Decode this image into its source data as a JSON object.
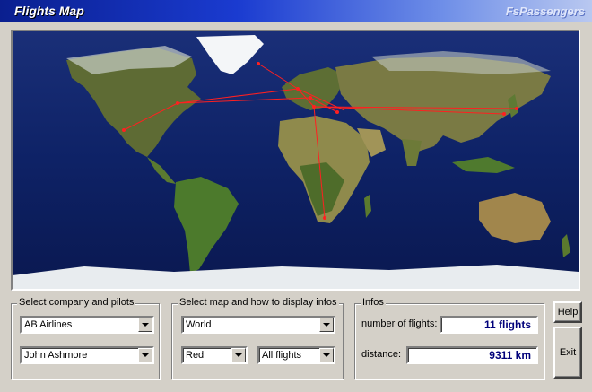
{
  "window": {
    "title": "Flights Map",
    "brand": "FsPassengers"
  },
  "company_group": {
    "title": "Select company and pilots",
    "company": "AB Airlines",
    "pilot": "John Ashmore"
  },
  "map_group": {
    "title": "Select map and how to display infos",
    "map": "World",
    "color": "Red",
    "filter": "All flights"
  },
  "infos_group": {
    "title": "Infos",
    "flights_label": "number of flights:",
    "flights_value": "11 flights",
    "distance_label": "distance:",
    "distance_value": "9311 km"
  },
  "buttons": {
    "help": "Help",
    "exit": "Exit"
  },
  "colors": {
    "route": "#ff2020",
    "ocean": "#0d1f5e",
    "land": "#5a6e2e"
  }
}
